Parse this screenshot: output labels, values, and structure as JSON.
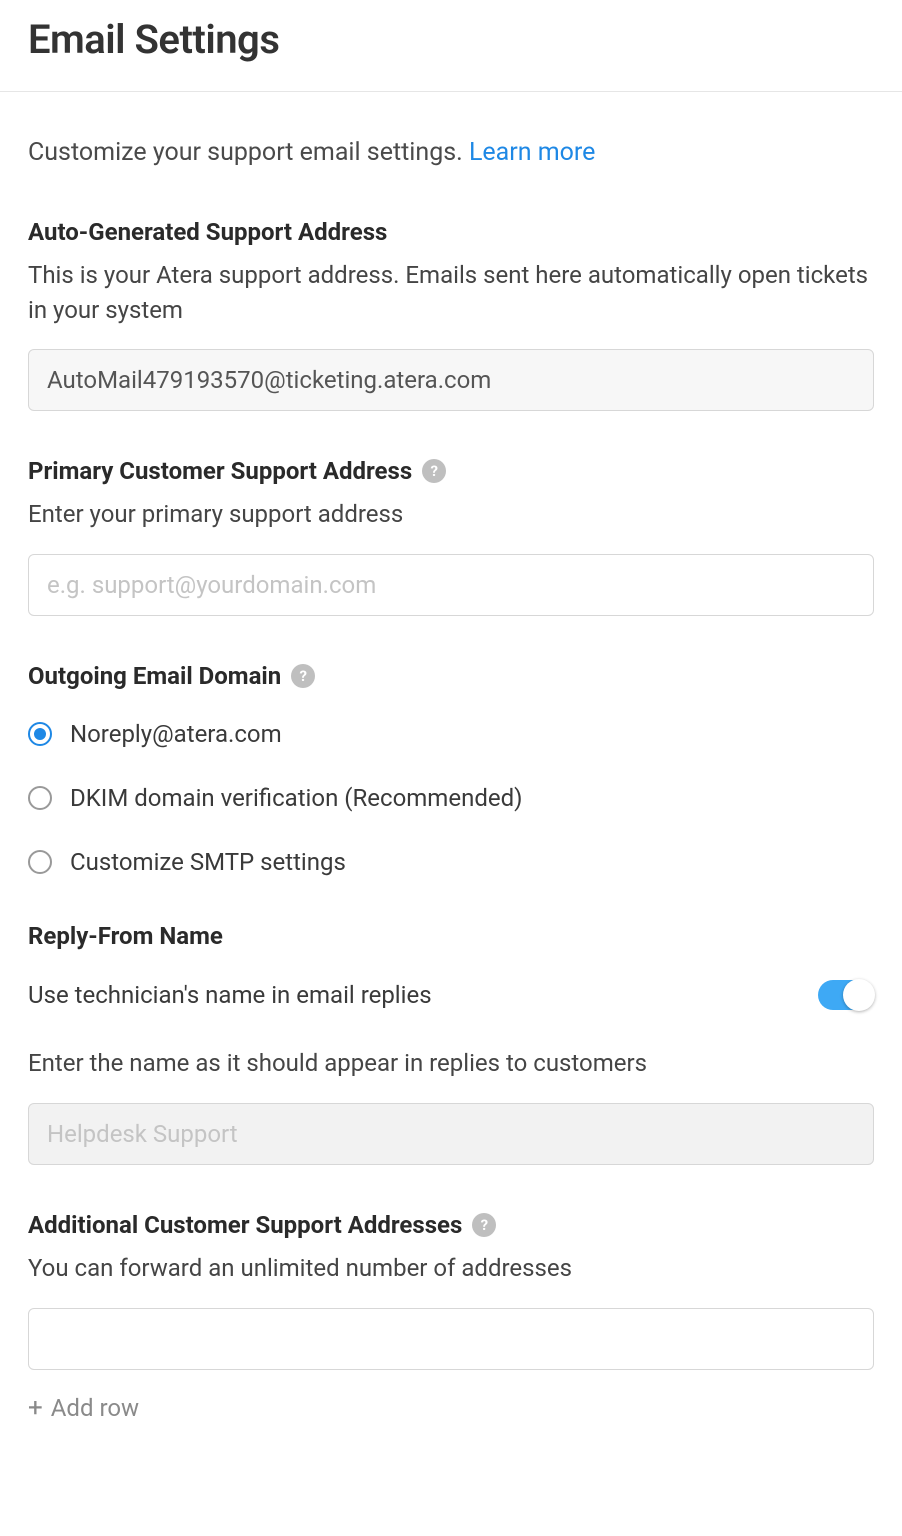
{
  "page_title": "Email Settings",
  "intro_text": "Customize your support email settings. ",
  "learn_more": "Learn more",
  "auto_gen": {
    "title": "Auto-Generated Support Address",
    "desc": "This is your Atera support address. Emails sent here automatically open tickets in your system",
    "value": "AutoMail479193570@ticketing.atera.com"
  },
  "primary": {
    "title": "Primary Customer Support Address",
    "desc": "Enter your primary support address",
    "placeholder": "e.g. support@yourdomain.com"
  },
  "outgoing": {
    "title": "Outgoing Email Domain",
    "options": [
      "Noreply@atera.com",
      "DKIM domain verification (Recommended)",
      "Customize SMTP settings"
    ]
  },
  "reply_from": {
    "title": "Reply-From Name",
    "toggle_label": "Use technician's name in email replies",
    "desc": "Enter the name as it should appear in replies to customers",
    "placeholder": "Helpdesk Support"
  },
  "additional": {
    "title": "Additional Customer Support Addresses",
    "desc": "You can forward an unlimited number of addresses",
    "add_row": "Add row"
  }
}
